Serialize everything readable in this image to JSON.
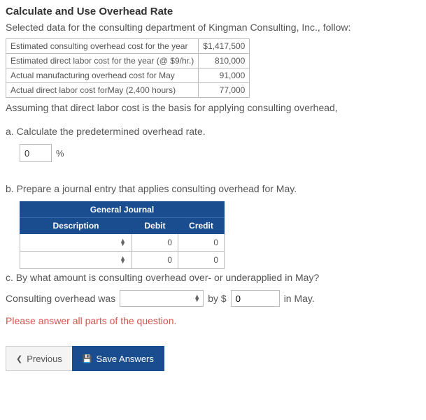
{
  "title": "Calculate and Use Overhead Rate",
  "intro": "Selected data for the consulting department of Kingman Consulting, Inc., follow:",
  "data_rows": [
    {
      "label": "Estimated consulting overhead cost for the year",
      "value": "$1,417,500"
    },
    {
      "label": "Estimated direct labor cost for the year (@ $9/hr.)",
      "value": "810,000"
    },
    {
      "label": "Actual manufacturing overhead cost for May",
      "value": "91,000"
    },
    {
      "label": "Actual direct labor cost forMay (2,400 hours)",
      "value": "77,000"
    }
  ],
  "assume": "Assuming that direct labor cost is the basis for applying consulting overhead,",
  "part_a": {
    "label": "a. Calculate the predetermined overhead rate.",
    "value": "0",
    "unit": "%"
  },
  "part_b": {
    "label": "b. Prepare a journal entry that applies consulting overhead for May.",
    "journal_title": "General Journal",
    "headers": {
      "desc": "Description",
      "debit": "Debit",
      "credit": "Credit"
    },
    "rows": [
      {
        "desc": "",
        "debit": "0",
        "credit": "0"
      },
      {
        "desc": "",
        "debit": "0",
        "credit": "0"
      }
    ]
  },
  "part_c": {
    "label": "c. By what amount is consulting overhead over- or underapplied in May?",
    "prefix": "Consulting overhead was",
    "select_value": "",
    "by_text": "by $",
    "amount": "0",
    "suffix": "in May."
  },
  "error": "Please answer all parts of the question.",
  "buttons": {
    "previous": "Previous",
    "save": "Save Answers"
  }
}
